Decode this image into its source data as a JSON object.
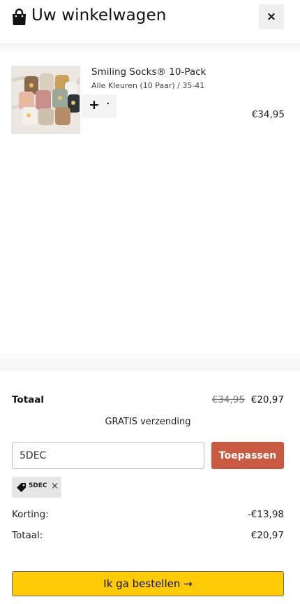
{
  "header": {
    "title": "Uw winkelwagen",
    "bag_icon": "shopping-bag-icon",
    "close_glyph": "×"
  },
  "cart": {
    "items": [
      {
        "name": "Smiling Socks® 10-Pack",
        "variant": "Alle Kleuren (10 Paar) / 35-41",
        "qty_plus": "+",
        "qty_dot": "·",
        "price": "€34,95"
      }
    ]
  },
  "summary": {
    "total_label": "Totaal",
    "total_old": "€34,95",
    "total_new": "€20,97",
    "shipping": "GRATIS verzending",
    "discount_code_value": "5DEC",
    "apply_label": "Toepassen",
    "applied_code": "5DEC",
    "remove_glyph": "×",
    "korting_label": "Korting:",
    "korting_value": "-€13,98",
    "totaal_label": "Totaal:",
    "totaal_value": "€20,97",
    "checkout_label": "Ik ga bestellen →"
  },
  "colors": {
    "accent_apply": "#c85b41",
    "checkout_bg": "#ffcb05"
  }
}
